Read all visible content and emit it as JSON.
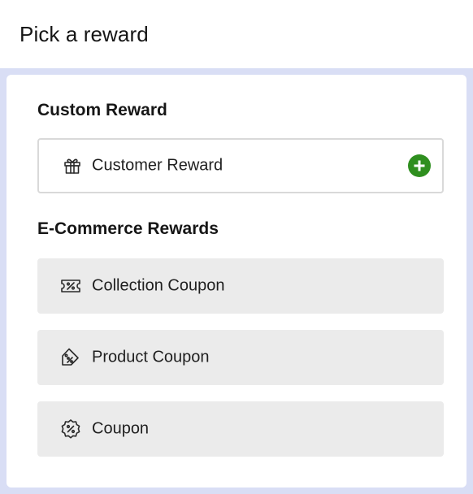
{
  "page": {
    "title": "Pick a reward"
  },
  "custom_section": {
    "title": "Custom Reward",
    "items": [
      {
        "label": "Customer Reward",
        "icon": "gift-icon",
        "action_icon": "add-circle-icon"
      }
    ]
  },
  "ecommerce_section": {
    "title": "E-Commerce Rewards",
    "items": [
      {
        "label": "Collection Coupon",
        "icon": "ticket-percent-icon"
      },
      {
        "label": "Product Coupon",
        "icon": "tag-percent-icon"
      },
      {
        "label": "Coupon",
        "icon": "badge-percent-icon"
      }
    ]
  },
  "colors": {
    "backdrop": "#d9def5",
    "item_bg": "#ebebeb",
    "add_button": "#2f8f1f"
  }
}
